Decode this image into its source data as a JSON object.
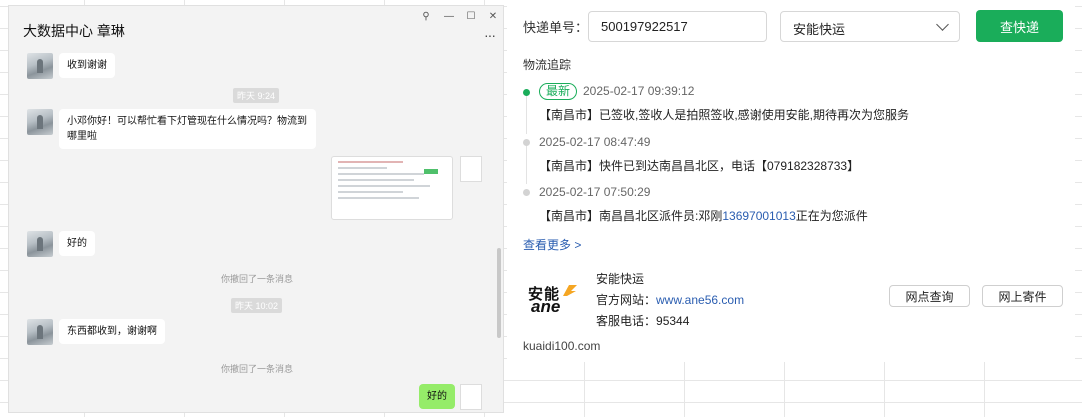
{
  "chat": {
    "title": "大数据中心 章琳",
    "window_controls": [
      "⚲",
      "—",
      "☐",
      "✕"
    ],
    "more": "···",
    "messages": [
      {
        "text": "收到谢谢"
      },
      {
        "time": "昨天 9:24"
      },
      {
        "text": "小邓你好！可以帮忙看下灯管现在什么情况吗？物流到哪里啦"
      },
      {
        "text": "好的"
      },
      {
        "system": "你撤回了一条消息"
      },
      {
        "time": "昨天 10:02"
      },
      {
        "text": "东西都收到，谢谢啊"
      },
      {
        "system": "你撤回了一条消息"
      },
      {
        "text": "好的",
        "mine": true
      }
    ]
  },
  "kuaidi": {
    "tracking_label": "快递单号：",
    "tracking_number": "500197922517",
    "company_select": "安能快运",
    "query_button": "查快递",
    "section_title": "物流追踪",
    "latest_badge": "最新",
    "events": [
      {
        "time": "2025-02-17 09:39:12",
        "desc": "【南昌市】已签收,签收人是拍照签收,感谢使用安能,期待再次为您服务"
      },
      {
        "time": "2025-02-17 08:47:49",
        "desc": "【南昌市】快件已到达南昌昌北区，电话【079182328733】"
      },
      {
        "time": "2025-02-17 07:50:29",
        "desc_prefix": "【南昌市】南昌昌北区派件员:邓刚",
        "desc_phone": "13697001013",
        "desc_suffix": "正在为您派件"
      }
    ],
    "see_more": "查看更多 >",
    "company": {
      "logo_text_top": "安能",
      "logo_text_bottom": "ane",
      "name": "安能快运",
      "site_label": "官方网站：",
      "site_url": "www.ane56.com",
      "tel_label": "客服电话：",
      "tel": "95344"
    },
    "outlet_button": "网点查询",
    "send_button": "网上寄件",
    "footer": "kuaidi100.com"
  },
  "colors": {
    "accent_green": "#1aad5a",
    "link_blue": "#2a5db0",
    "my_bubble": "#95ec69"
  }
}
